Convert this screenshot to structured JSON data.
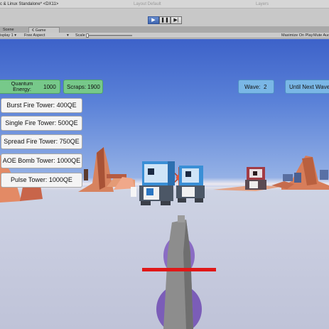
{
  "window": {
    "title": "c & Linux Standalone* <DX11>",
    "ghost_text_1": "Layout  Default",
    "ghost_text_2": "Layers"
  },
  "toolbar": {
    "play_icon": "▶",
    "pause_icon": "❚❚",
    "step_icon": "▶|"
  },
  "tabs": {
    "scene": "Scene",
    "game_icon": "€",
    "game": "Game"
  },
  "game_bar": {
    "display": "isplay 1",
    "display_arrow": "▾",
    "aspect": "Free Aspect",
    "aspect_arrow": "▾",
    "scale_label": "Scale",
    "maximize": "Maximize On Play",
    "mute": "Mute Aud"
  },
  "hud": {
    "energy_label": "Quantum Energy:",
    "energy_value": "1000",
    "scraps_label": "Scraps:",
    "scraps_value": "1900",
    "wave_label": "Wave:",
    "wave_value": "2",
    "next_wave_label": "Until Next Wave:"
  },
  "towers": [
    {
      "label": "Burst Fire Tower: 400QE"
    },
    {
      "label": "Single Fire Tower: 500QE"
    },
    {
      "label": "Spread Fire Tower: 750QE"
    },
    {
      "label": "AOE Bomb Tower: 1000QE"
    },
    {
      "label": "Pulse Tower: 1000QE"
    }
  ],
  "colors": {
    "play_accent": "#3f66b0",
    "energy_panel": "#77c98a",
    "wave_panel": "#7ab7e6",
    "health_bar": "#e01818",
    "player_orb": "#8a6cc4"
  }
}
